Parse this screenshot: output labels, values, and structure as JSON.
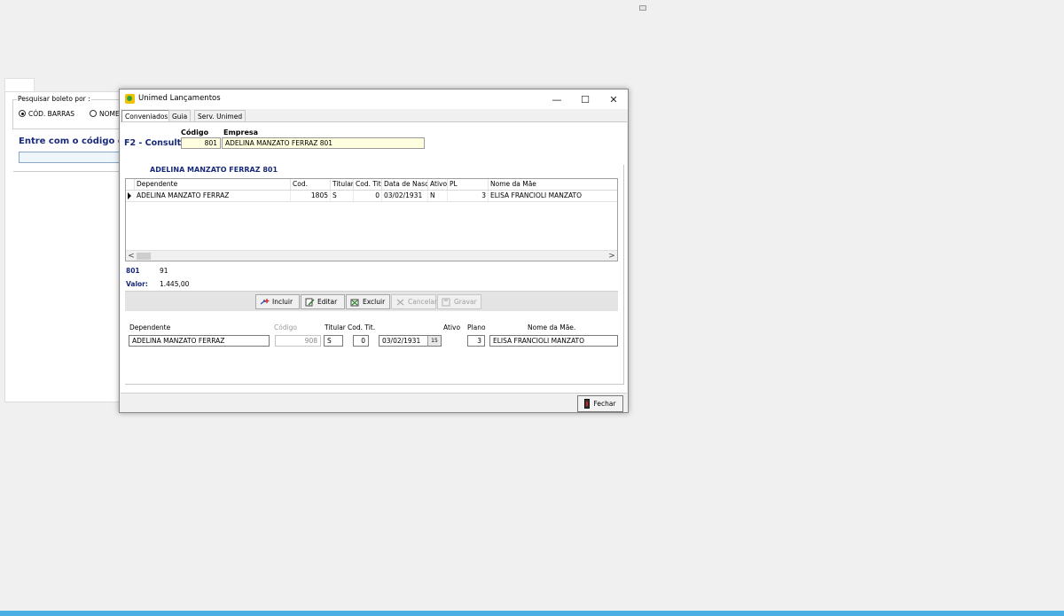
{
  "background_form": {
    "group_title": "Pesquisar boleto por :",
    "radio_barcode": "CÓD. BARRAS",
    "radio_name": "NOME",
    "barcode_title": "Entre com o código de barras"
  },
  "window": {
    "title": "Unimed Lançamentos",
    "minimize": "—",
    "maximize": "☐",
    "close": "✕",
    "tabs": [
      "Conveniados",
      "Guia",
      "Serv. Unimed"
    ]
  },
  "consulta": {
    "f2_label": "F2 - Consulta",
    "codigo_label": "Código",
    "empresa_label": "Empresa",
    "codigo_value": "801",
    "empresa_value": "ADELINA MANZATO FERRAZ 801"
  },
  "holder_title": "ADELINA MANZATO FERRAZ 801",
  "grid": {
    "columns": [
      "Dependente",
      "Cod.",
      "Titular",
      "Cod. Tit.",
      "Data de Nasc.",
      "Ativo",
      "PL",
      "Nome da Mãe"
    ],
    "rows": [
      {
        "dependente": "ADELINA MANZATO FERRAZ",
        "cod": "1805",
        "titular": "S",
        "cod_tit": "0",
        "data_nasc": "03/02/1931",
        "ativo": "N",
        "pl": "3",
        "nome_mae": "ELISA FRANCIOLI MANZATO"
      }
    ],
    "scroll_left": "<",
    "scroll_right": ">"
  },
  "info": {
    "code": "801",
    "count": "91",
    "valor_label": "Valor:",
    "valor_value": "1.445,00"
  },
  "toolbar": {
    "incluir": "Incluir",
    "editar": "Editar",
    "excluir": "Excluir",
    "cancelar": "Cancelar",
    "gravar": "Gravar"
  },
  "form": {
    "dependente_label": "Dependente",
    "codigo_label": "Código",
    "titular_label": "Titular",
    "cod_tit_label": "Cod. Tit.",
    "ativo_label": "Ativo",
    "plano_label": "Plano",
    "nome_mae_label": "Nome da Mãe.",
    "dependente_value": "ADELINA MANZATO FERRAZ",
    "codigo_value": "908",
    "titular_value": "S",
    "cod_tit_value": "0",
    "data_value": "03/02/1931",
    "calendar_glyph": "15",
    "plano_value": "3",
    "nome_mae_value": "ELISA FRANCIOLI MANZATO"
  },
  "fechar_label": "Fechar"
}
